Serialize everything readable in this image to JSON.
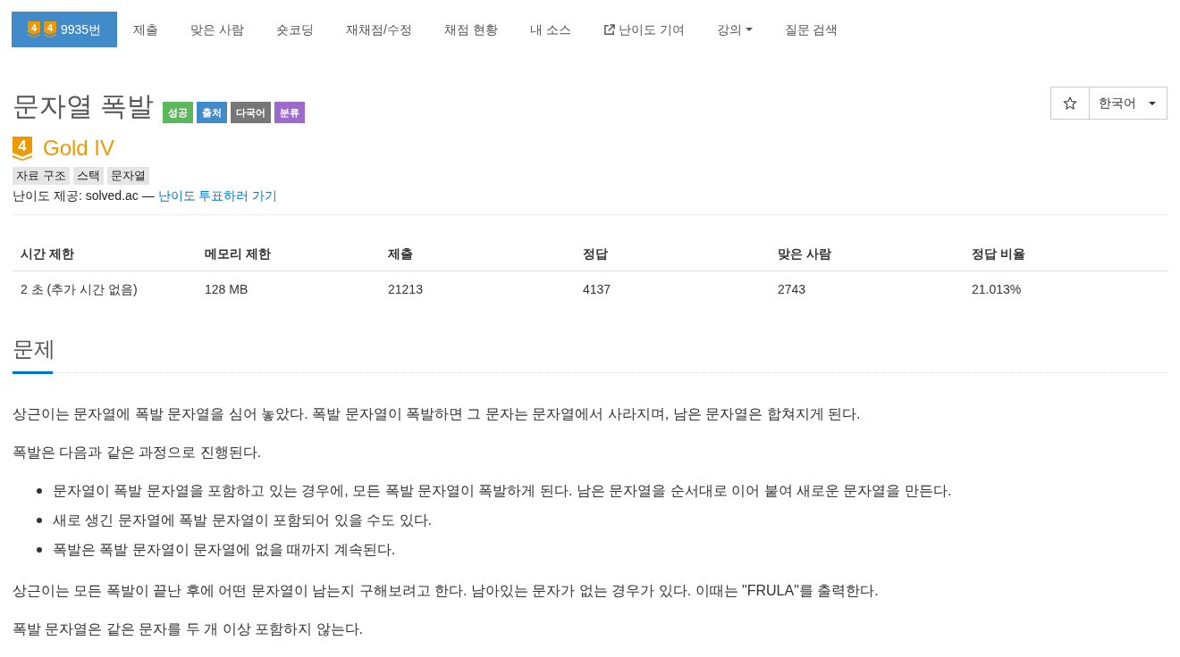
{
  "nav": {
    "items": [
      {
        "kind": "problem",
        "badges": [
          "4",
          "4"
        ],
        "label": "9935번",
        "selected": true
      },
      {
        "kind": "link",
        "label": "제출",
        "selected": false
      },
      {
        "kind": "link",
        "label": "맞은 사람",
        "selected": false
      },
      {
        "kind": "link",
        "label": "숏코딩",
        "selected": false
      },
      {
        "kind": "link",
        "label": "재채점/수정",
        "selected": false
      },
      {
        "kind": "link",
        "label": "채점 현황",
        "selected": false
      },
      {
        "kind": "link",
        "label": "내 소스",
        "selected": false
      },
      {
        "kind": "external",
        "label": "난이도 기여",
        "selected": false
      },
      {
        "kind": "dropdown",
        "label": "강의",
        "selected": false
      },
      {
        "kind": "link",
        "label": "질문 검색",
        "selected": false
      }
    ]
  },
  "problem": {
    "title": "문자열 폭발",
    "labels": [
      {
        "text": "성공",
        "color": "#5cb85c"
      },
      {
        "text": "출처",
        "color": "#428bca"
      },
      {
        "text": "다국어",
        "color": "#777777"
      },
      {
        "text": "분류",
        "color": "#9a6bcb"
      }
    ],
    "actions": {
      "starred": false,
      "language": "한국어"
    },
    "tier": {
      "badge": "4",
      "name": "Gold IV"
    },
    "tags": [
      "자료 구조",
      "스택",
      "문자열"
    ],
    "difficulty_note": {
      "text": "난이도 제공: solved.ac —",
      "link": "난이도 투표하러 가기"
    }
  },
  "info_table": {
    "columns": [
      "시간 제한",
      "메모리 제한",
      "제출",
      "정답",
      "맞은 사람",
      "정답 비율"
    ],
    "rows": [
      [
        "2 초 (추가 시간 없음)",
        "128 MB",
        "21213",
        "4137",
        "2743",
        "21.013%"
      ]
    ]
  },
  "section": {
    "heading": "문제",
    "blocks": [
      {
        "kind": "paragraph",
        "text": "상근이는 문자열에 폭발 문자열을 심어 놓았다. 폭발 문자열이 폭발하면 그 문자는 문자열에서 사라지며, 남은 문자열은 합쳐지게 된다."
      },
      {
        "kind": "paragraph",
        "text": "폭발은 다음과 같은 과정으로 진행된다."
      },
      {
        "kind": "list",
        "items": [
          "문자열이 폭발 문자열을 포함하고 있는 경우에, 모든 폭발 문자열이 폭발하게 된다. 남은 문자열을 순서대로 이어 붙여 새로운 문자열을 만든다.",
          "새로 생긴 문자열에 폭발 문자열이 포함되어 있을 수도 있다.",
          "폭발은 폭발 문자열이 문자열에 없을 때까지 계속된다."
        ]
      },
      {
        "kind": "paragraph",
        "text": "상근이는 모든 폭발이 끝난 후에 어떤 문자열이 남는지 구해보려고 한다. 남아있는 문자가 없는 경우가 있다. 이때는 \"FRULA\"를 출력한다."
      },
      {
        "kind": "paragraph",
        "text": "폭발 문자열은 같은 문자를 두 개 이상 포함하지 않는다."
      }
    ]
  }
}
